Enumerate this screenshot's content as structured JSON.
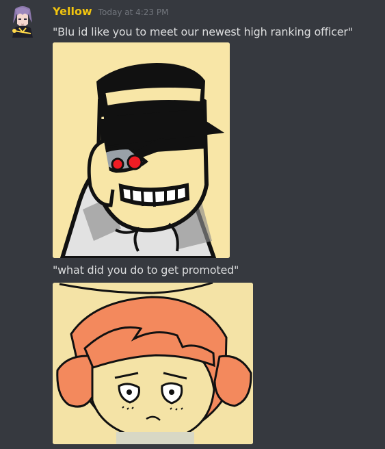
{
  "message_group": {
    "author": {
      "name": "Yellow",
      "name_color": "#f1c40f",
      "avatar_icon": "anime-avatar-icon"
    },
    "timestamp": "Today at 4:23 PM",
    "messages": [
      {
        "text": "\"Blu id like you to meet our newest high ranking officer\"",
        "attachment": {
          "kind": "image",
          "icon": "comic-officer-image"
        }
      },
      {
        "text": "\"what did you do to get promoted\"",
        "attachment": {
          "kind": "image",
          "icon": "comic-girl-image"
        }
      }
    ]
  },
  "colors": {
    "background": "#36393f",
    "text": "#dcddde",
    "timestamp": "#72767d"
  }
}
